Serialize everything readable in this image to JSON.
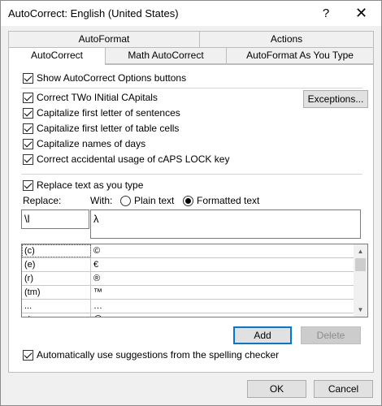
{
  "window": {
    "title": "AutoCorrect: English (United States)",
    "help_glyph": "?",
    "close_glyph": "✕"
  },
  "tabs": {
    "row1": [
      "AutoFormat",
      "Actions"
    ],
    "row2": [
      "AutoCorrect",
      "Math AutoCorrect",
      "AutoFormat As You Type"
    ]
  },
  "options": {
    "show_buttons": "Show AutoCorrect Options buttons",
    "two_initial": "Correct TWo INitial CApitals",
    "first_letter_sentences": "Capitalize first letter of sentences",
    "first_letter_cells": "Capitalize first letter of table cells",
    "names_of_days": "Capitalize names of days",
    "caps_lock": "Correct accidental usage of cAPS LOCK key",
    "exceptions_button": "Exceptions..."
  },
  "replace": {
    "checkbox_label": "Replace text as you type",
    "replace_label": "Replace:",
    "with_label": "With:",
    "plain_text": "Plain text",
    "formatted_text": "Formatted text",
    "selected_format": "Formatted text",
    "replace_value": "\\l",
    "with_value": "λ"
  },
  "entries": [
    {
      "replace": "(c)",
      "with": "©"
    },
    {
      "replace": "(e)",
      "with": "€"
    },
    {
      "replace": "(r)",
      "with": "®"
    },
    {
      "replace": "(tm)",
      "with": "™"
    },
    {
      "replace": "...",
      "with": "…"
    },
    {
      "replace": ":(",
      "with": "☹"
    }
  ],
  "list_scroll": {
    "up_glyph": "▲",
    "down_glyph": "▼"
  },
  "buttons": {
    "add": "Add",
    "delete": "Delete",
    "ok": "OK",
    "cancel": "Cancel"
  },
  "spelling": {
    "label": "Automatically use suggestions from the spelling checker"
  },
  "colors": {
    "accent": "#0078d7",
    "dialog_bg": "#f0f0f0"
  }
}
